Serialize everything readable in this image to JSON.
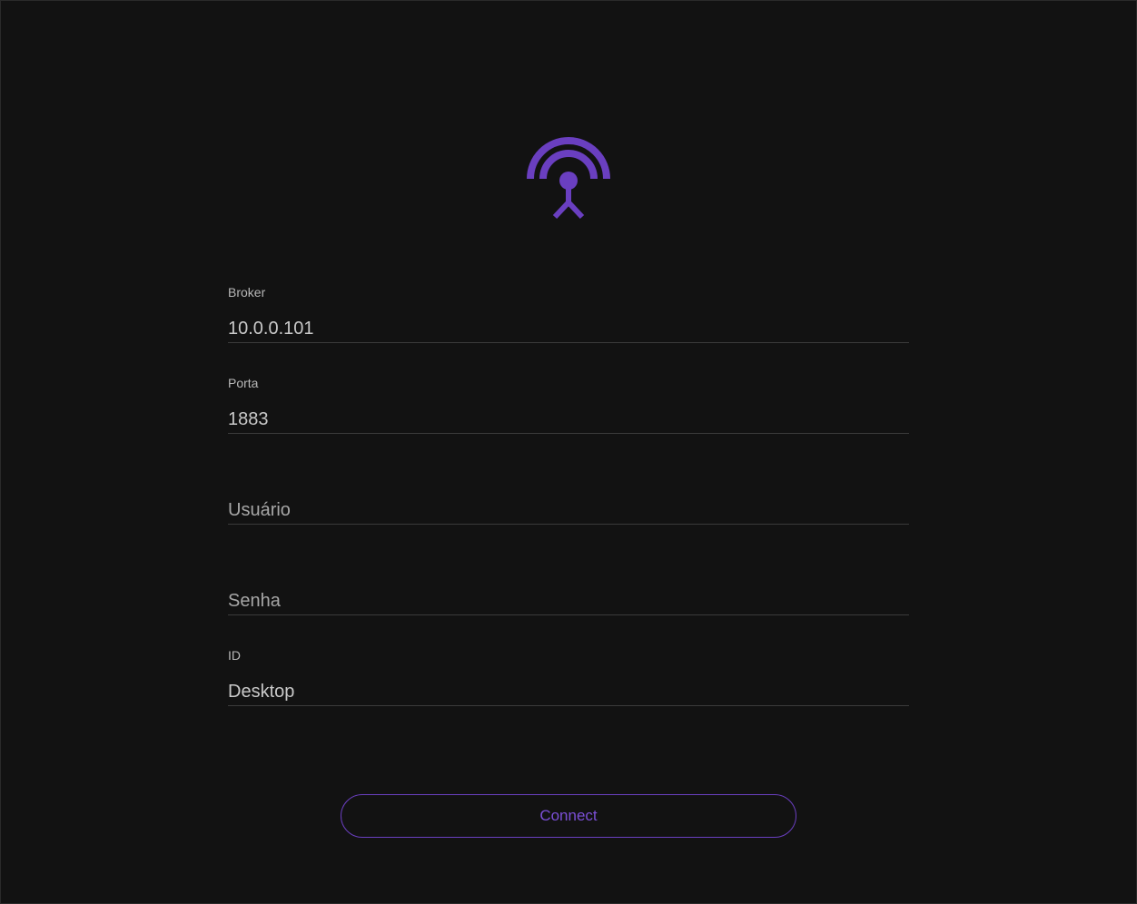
{
  "app": {
    "accent_color": "#6a3fc0",
    "logo_icon": "broadcast-antenna-icon"
  },
  "form": {
    "broker": {
      "label": "Broker",
      "value": "10.0.0.101"
    },
    "port": {
      "label": "Porta",
      "value": "1883"
    },
    "user": {
      "placeholder": "Usuário",
      "value": ""
    },
    "password": {
      "placeholder": "Senha",
      "value": ""
    },
    "client_id": {
      "label": "ID",
      "value": "Desktop"
    }
  },
  "actions": {
    "connect_label": "Connect"
  }
}
